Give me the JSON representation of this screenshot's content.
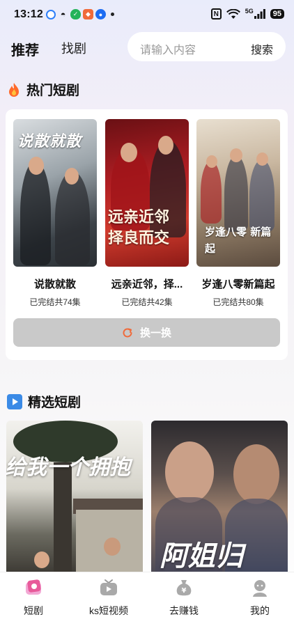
{
  "status_bar": {
    "time": "13:12",
    "signal": "5G",
    "battery": "95"
  },
  "header": {
    "tabs": [
      {
        "label": "推荐",
        "active": true
      },
      {
        "label": "找剧",
        "active": false
      }
    ],
    "search": {
      "placeholder": "请输入内容",
      "button_label": "搜索"
    }
  },
  "hot_section": {
    "title": "热门短剧",
    "icon": "fire-icon",
    "dramas": [
      {
        "title": "说散就散",
        "status": "已完结共74集",
        "poster_text": "说散就散"
      },
      {
        "title": "远亲近邻，择...",
        "status": "已完结共42集",
        "poster_text": "远亲近邻 择良而交"
      },
      {
        "title": "岁逢八零新篇起",
        "status": "已完结共80集",
        "poster_text": "岁逢八零 新篇起"
      }
    ],
    "refresh_label": "换一换"
  },
  "selected_section": {
    "title": "精选短剧",
    "icon": "play-icon",
    "posters": [
      {
        "poster_text": "给我一个拥抱"
      },
      {
        "poster_text": "阿姐归"
      }
    ]
  },
  "bottom_nav": {
    "items": [
      {
        "label": "短剧",
        "icon": "drama-icon",
        "active": true
      },
      {
        "label": "ks短视频",
        "icon": "tv-icon",
        "active": false
      },
      {
        "label": "去赚钱",
        "icon": "money-bag-icon",
        "active": false
      },
      {
        "label": "我的",
        "icon": "profile-icon",
        "active": false
      }
    ]
  },
  "colors": {
    "accent": "#f06a3a",
    "refresh_bg": "#c9c9c9",
    "nav_active": "#e85a9a"
  }
}
